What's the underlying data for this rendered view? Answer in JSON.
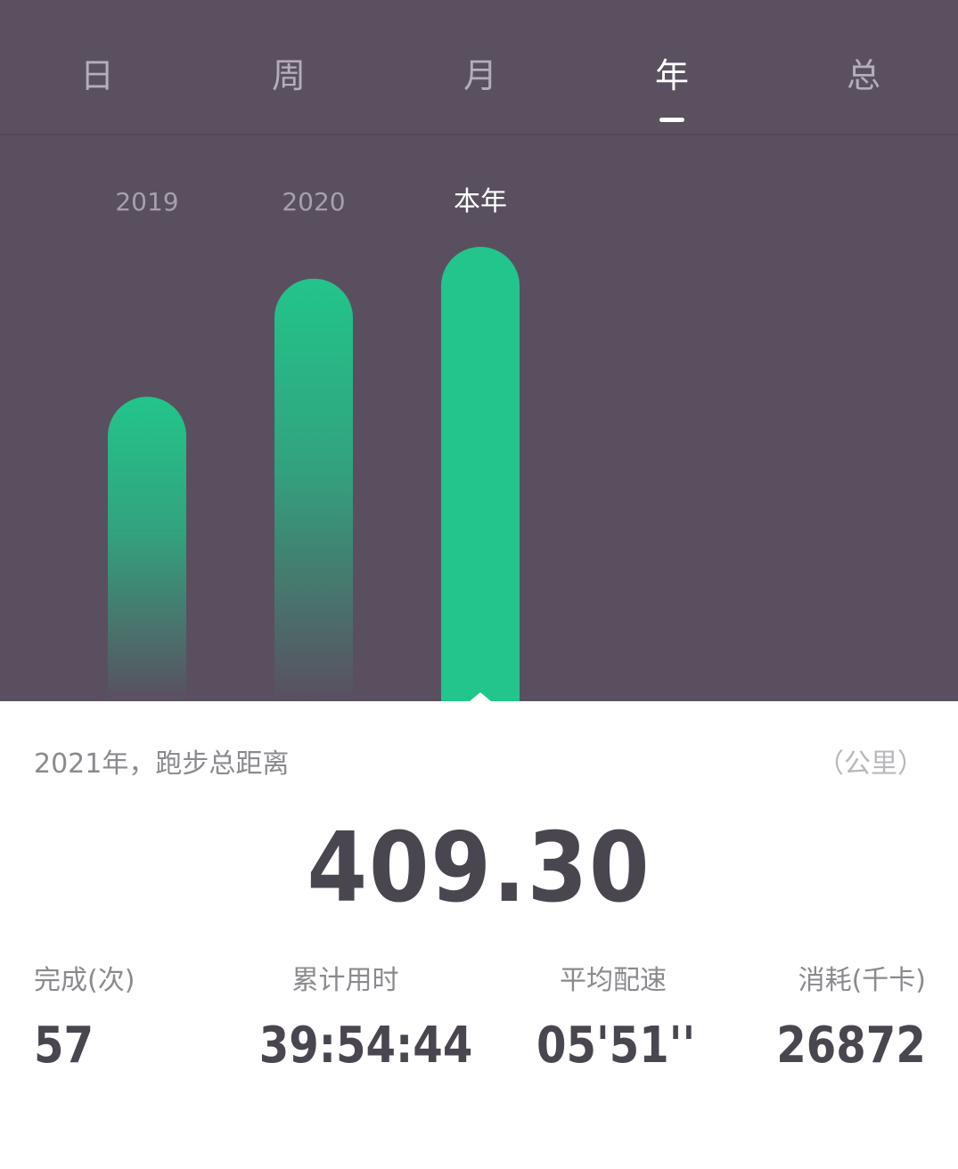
{
  "tabs": [
    {
      "label": "日",
      "active": false
    },
    {
      "label": "周",
      "active": false
    },
    {
      "label": "月",
      "active": false
    },
    {
      "label": "年",
      "active": true
    },
    {
      "label": "总",
      "active": false
    }
  ],
  "colors": {
    "background_dark": "#5a4f5f",
    "bar_green": "#22c58b",
    "text_dark": "#4a4650",
    "text_gray": "#8a8a8f"
  },
  "chart_data": {
    "type": "bar",
    "categories": [
      "2019",
      "2020",
      "本年"
    ],
    "selected": "本年",
    "relative_heights": [
      0.67,
      0.93,
      1.0
    ],
    "faded": [
      true,
      true,
      false
    ]
  },
  "summary": {
    "title": "2021年，跑步总距离",
    "unit": "（公里）",
    "value": "409.30"
  },
  "stats": [
    {
      "label": "完成(次)",
      "value": "57"
    },
    {
      "label": "累计用时",
      "value": "39:54:44"
    },
    {
      "label": "平均配速",
      "value": "05'51''"
    },
    {
      "label": "消耗(千卡)",
      "value": "26872"
    }
  ]
}
